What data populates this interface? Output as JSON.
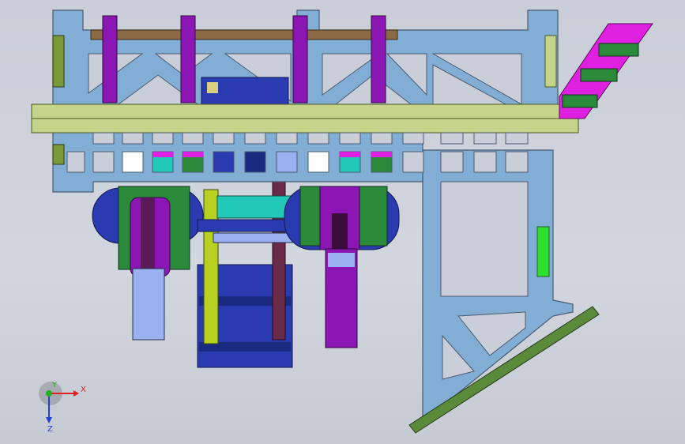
{
  "viewport": {
    "background_top": "#c9ced8",
    "background_bottom": "#c6cad2"
  },
  "colors": {
    "frame": "#82aed6",
    "frame_edge": "#4a5a70",
    "beam": "#c6d38a",
    "brown_beam": "#8a6a44",
    "purple": "#8c16b4",
    "dark_purple": "#5a1a5a",
    "magenta": "#e020e0",
    "green": "#2a8a3a",
    "olive": "#7a9a3a",
    "blue": "#2a3ab0",
    "light_blue": "#9ab0f0",
    "cyan": "#22c8b8"
  },
  "axis_triad": {
    "x_label": "X",
    "y_label": "Y",
    "z_label": "Z",
    "x_color": "#e02020",
    "y_color": "#20b020",
    "z_color": "#2040d0"
  }
}
